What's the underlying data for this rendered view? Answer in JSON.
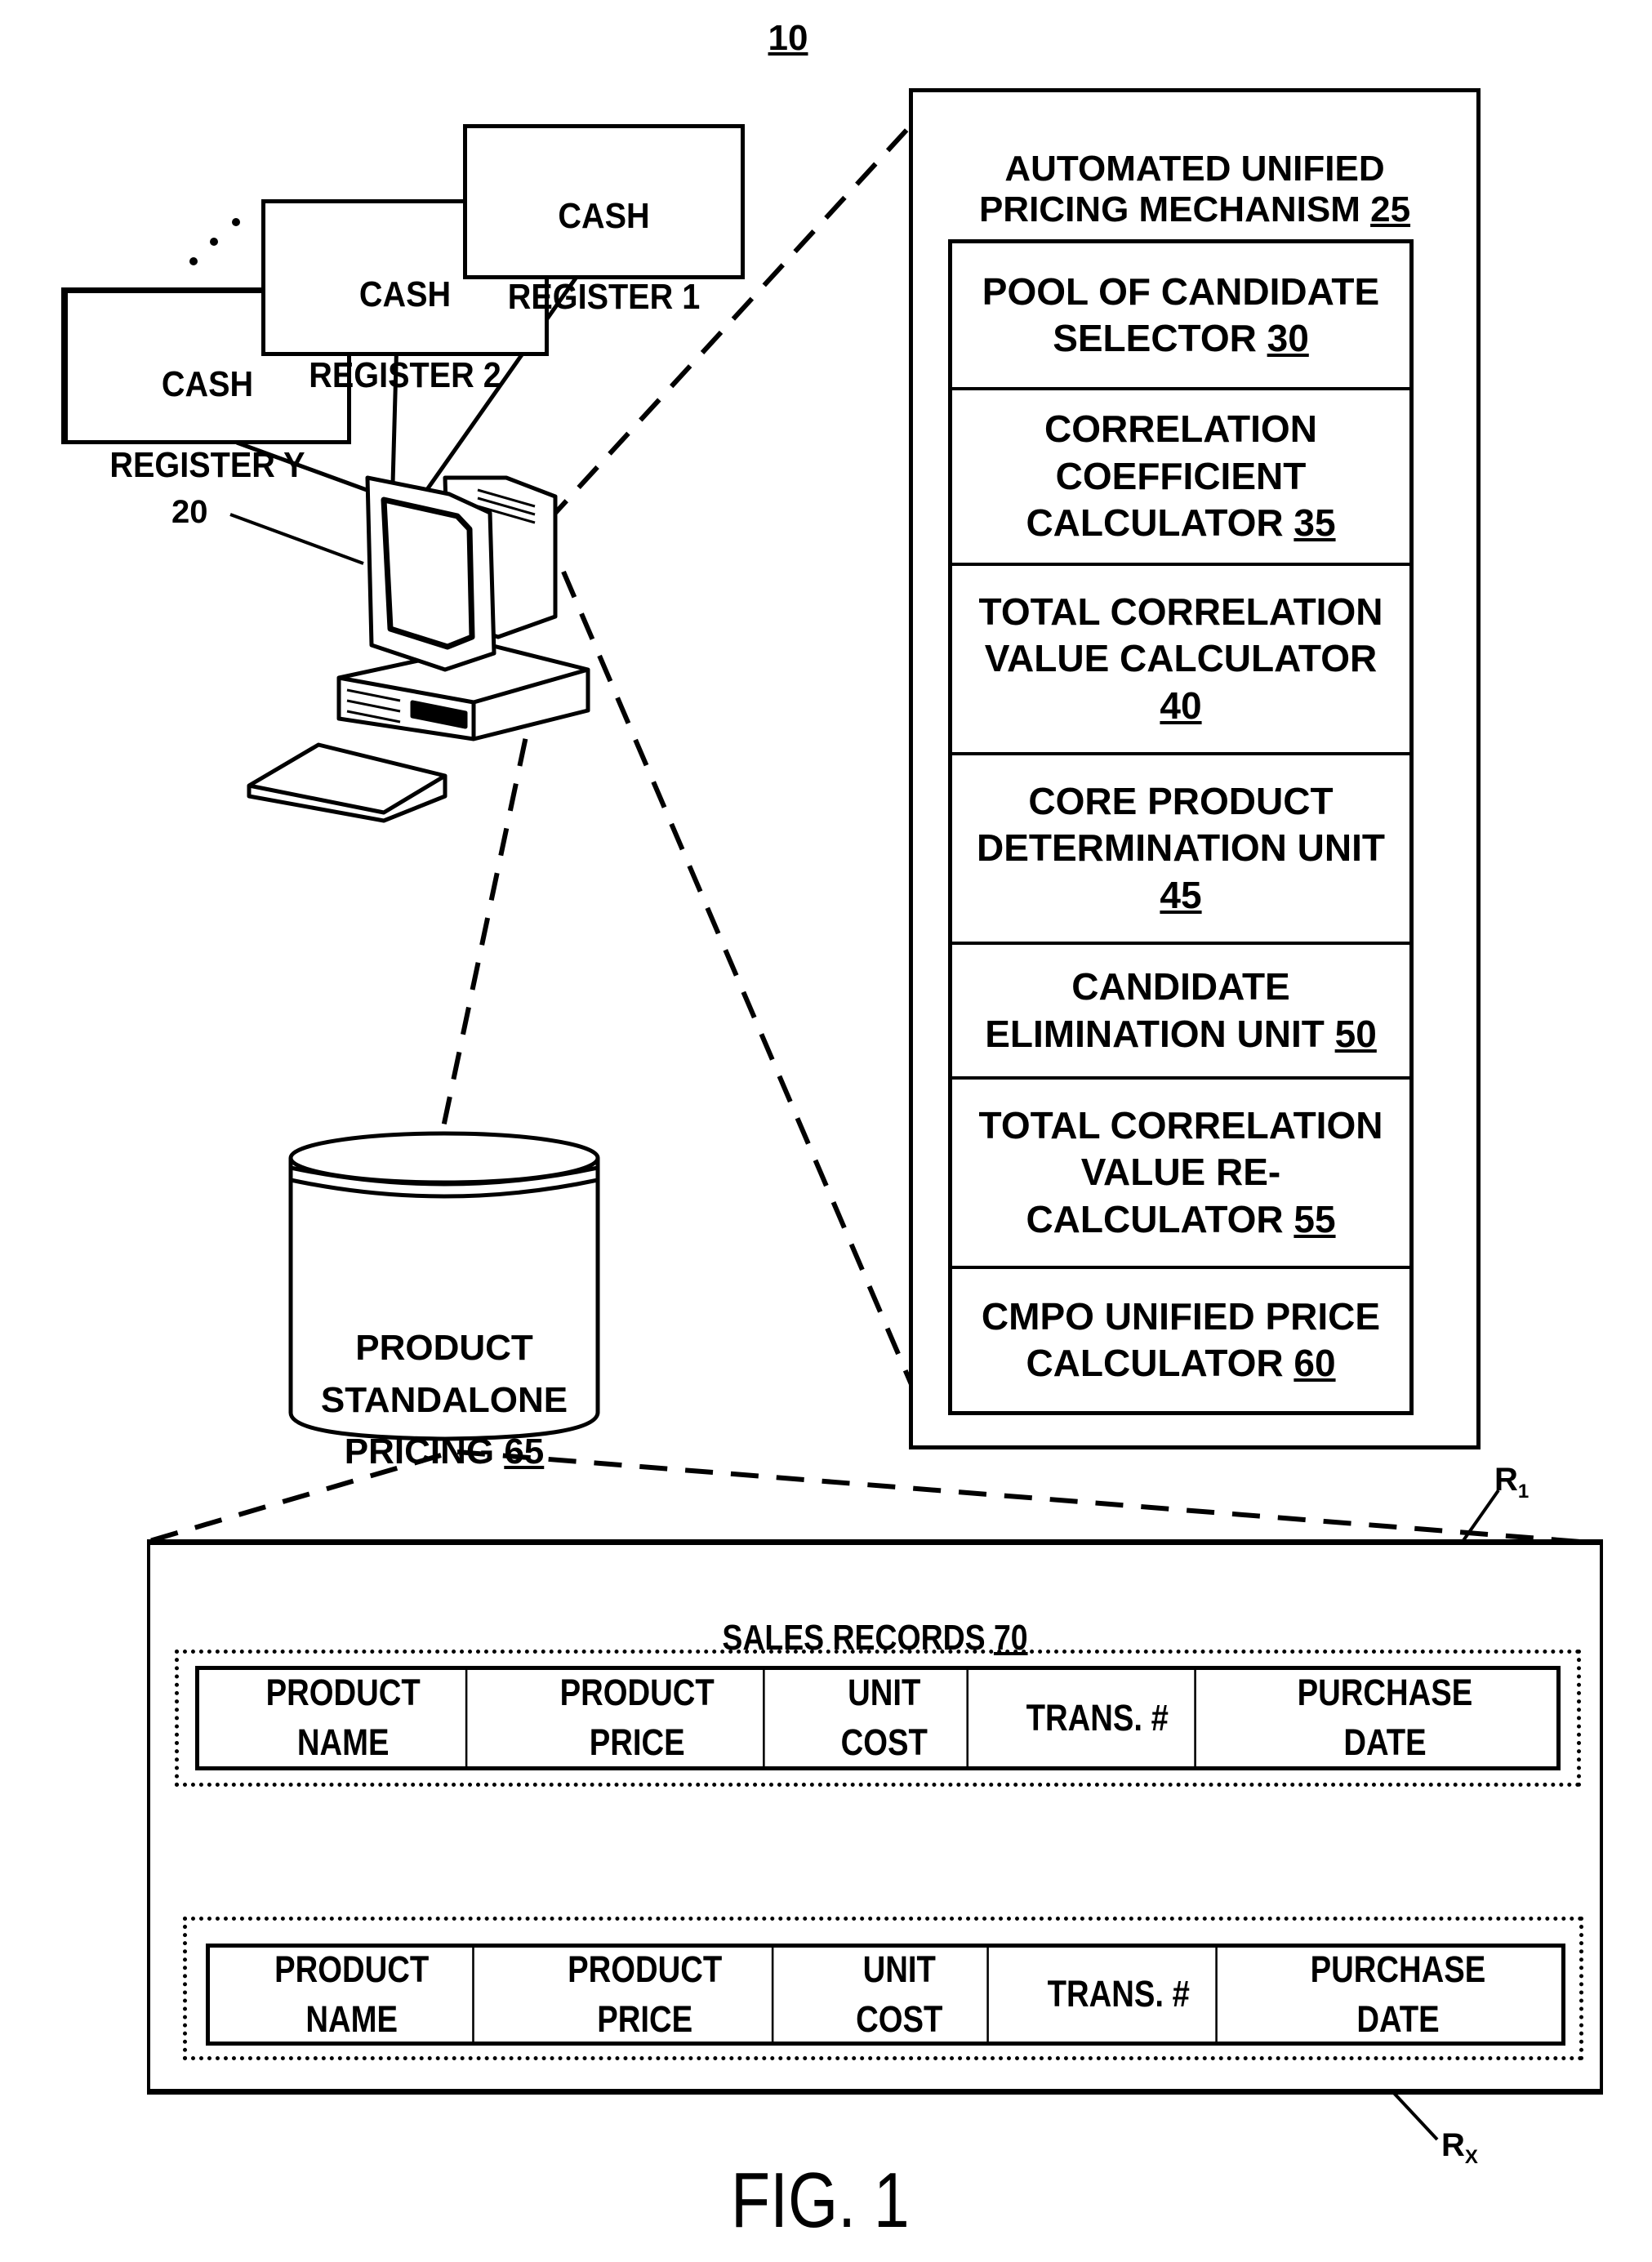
{
  "figure": {
    "ref_number": "10",
    "caption": "FIG. 1"
  },
  "cash_registers": [
    {
      "line1": "CASH",
      "line2": "REGISTER 1"
    },
    {
      "line1": "CASH",
      "line2": "REGISTER 2"
    },
    {
      "line1": "CASH",
      "line2": "REGISTER Y"
    }
  ],
  "ellipsis": "· · ·",
  "computer": {
    "ref": "20"
  },
  "mechanism": {
    "title": "AUTOMATED UNIFIED\nPRICING MECHANISM",
    "ref": "25",
    "units": [
      {
        "label": "POOL OF CANDIDATE\nSELECTOR",
        "ref": "30"
      },
      {
        "label": "CORRELATION\nCOEFFICIENT\nCALCULATOR",
        "ref": "35"
      },
      {
        "label": "TOTAL CORRELATION\nVALUE CALCULATOR\n",
        "ref": "40"
      },
      {
        "label": "CORE PRODUCT\nDETERMINATION UNIT\n",
        "ref": "45"
      },
      {
        "label": "CANDIDATE\nELIMINATION UNIT",
        "ref": "50"
      },
      {
        "label": "TOTAL CORRELATION\nVALUE RE-\nCALCULATOR",
        "ref": "55"
      },
      {
        "label": "CMPO UNIFIED PRICE\nCALCULATOR",
        "ref": "60"
      }
    ]
  },
  "database": {
    "label": "PRODUCT\nSTANDALONE\nPRICING",
    "ref": "65"
  },
  "sales_records": {
    "title": "SALES RECORDS",
    "ref": "70",
    "columns": [
      "PRODUCT\nNAME",
      "PRODUCT\nPRICE",
      "UNIT\nCOST",
      "TRANS. #",
      "PURCHASE\nDATE"
    ],
    "first_record_label": "R1",
    "last_record_label": "Rx",
    "first_record_sub": "1",
    "last_record_sub": "X",
    "row_ellipsis": "⋮"
  }
}
